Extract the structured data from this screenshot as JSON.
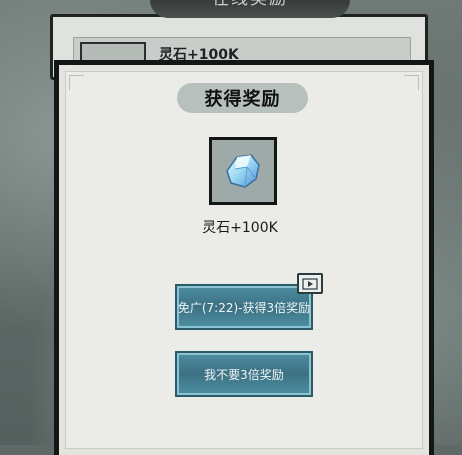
{
  "background_panel": {
    "title": "在线奖励",
    "item_text": "灵石+100K"
  },
  "dialog": {
    "title": "获得奖励",
    "reward": {
      "icon": "spirit-stone-icon",
      "label": "灵石+100K"
    },
    "ad_button_label": "免广(7:22)-获得3倍奖励",
    "ad_badge_icon": "video-play-icon",
    "decline_button_label": "我不要3倍奖励"
  },
  "colors": {
    "button": "#3c7183",
    "dialog_bg": "#ebece7",
    "title_pill": "#b8c0bd"
  }
}
